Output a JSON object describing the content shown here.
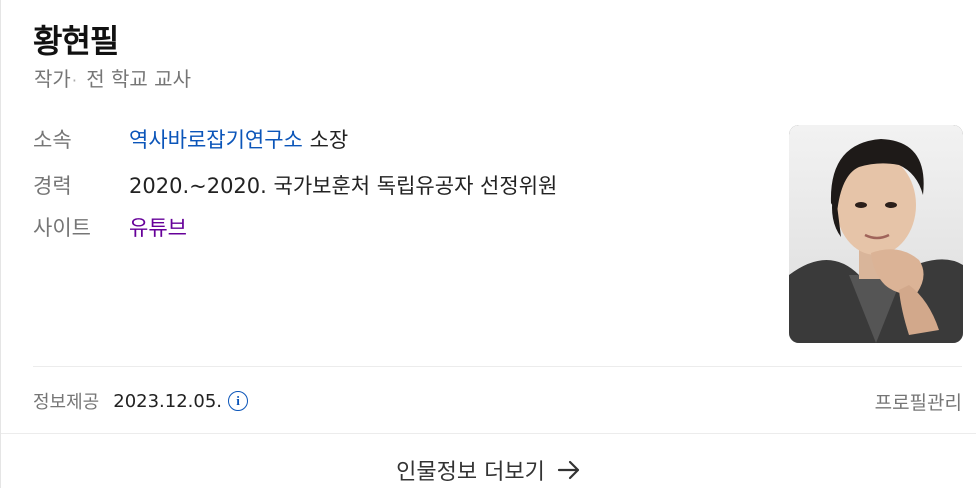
{
  "profile": {
    "name": "황현필",
    "subtitle_main": "작가",
    "subtitle_dot": "·",
    "subtitle_extra": "전 학교 교사"
  },
  "rows": [
    {
      "label": "소속",
      "link": "역사바로잡기연구소",
      "value": " 소장"
    },
    {
      "label": "경력",
      "value": "2020.~2020. 국가보훈처 독립유공자 선정위원"
    },
    {
      "label": "사이트",
      "link": "유튜브"
    }
  ],
  "footer": {
    "label": "정보제공",
    "date": "2023.12.05.",
    "info_icon": "i",
    "manage_label": "프로필관리"
  },
  "more": {
    "label": "인물정보 더보기",
    "icon": "arrow-right-icon"
  },
  "colors": {
    "link_blue": "#0b55b9",
    "link_visited": "#660099",
    "muted": "#767676"
  }
}
